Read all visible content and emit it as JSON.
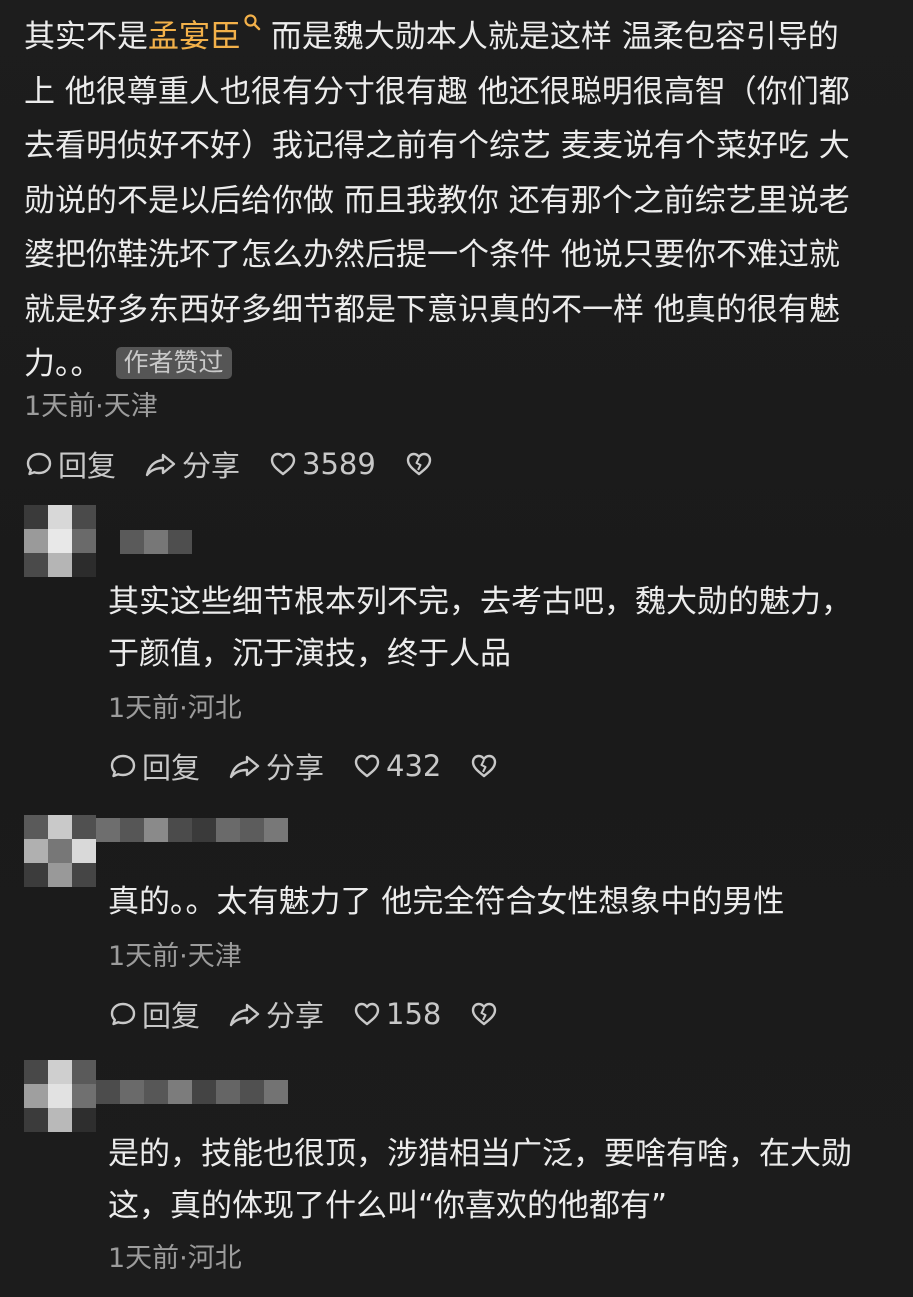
{
  "top_comment": {
    "lines": [
      {
        "pre": "其实不是",
        "mention": "孟宴臣",
        "post": " 而是魏大勋本人就是这样 温柔包容引导的"
      },
      {
        "text": "上 他很尊重人也很有分寸很有趣 他还很聪明很高智（你们都"
      },
      {
        "text": "去看明侦好不好）我记得之前有个综艺 麦麦说有个菜好吃 大"
      },
      {
        "text": "勋说的不是以后给你做 而且我教你 还有那个之前综艺里说老"
      },
      {
        "text": "婆把你鞋洗坏了怎么办然后提一个条件 他说只要你不难过就"
      },
      {
        "text": "就是好多东西好多细节都是下意识真的不一样 他真的很有魅"
      },
      {
        "text": "力。。"
      }
    ],
    "author_tag": "作者赞过",
    "meta": "1天前·天津",
    "reply_label": "回复",
    "share_label": "分享",
    "likes": "3589"
  },
  "replies": [
    {
      "lines": [
        "其实这些细节根本列不完，去考古吧，魏大勋的魅力，",
        "于颜值，沉于演技，终于人品"
      ],
      "meta": "1天前·河北",
      "reply_label": "回复",
      "share_label": "分享",
      "likes": "432"
    },
    {
      "lines": [
        "真的。。太有魅力了 他完全符合女性想象中的男性"
      ],
      "meta": "1天前·天津",
      "reply_label": "回复",
      "share_label": "分享",
      "likes": "158"
    },
    {
      "lines": [
        "是的，技能也很顶，涉猎相当广泛，要啥有啥，在大勋",
        "这，真的体现了什么叫“你喜欢的他都有”"
      ],
      "meta": "1天前·河北"
    }
  ],
  "icons": {
    "reply": "comment-bubble-icon",
    "share": "share-arrow-icon",
    "like": "heart-icon",
    "dislike": "broken-heart-icon",
    "mention": "search-icon"
  },
  "colors": {
    "background": "#1b1b1b",
    "text": "#ececec",
    "meta": "#9c9c9c",
    "mention": "#f3b14a",
    "tag_bg": "#555555"
  }
}
